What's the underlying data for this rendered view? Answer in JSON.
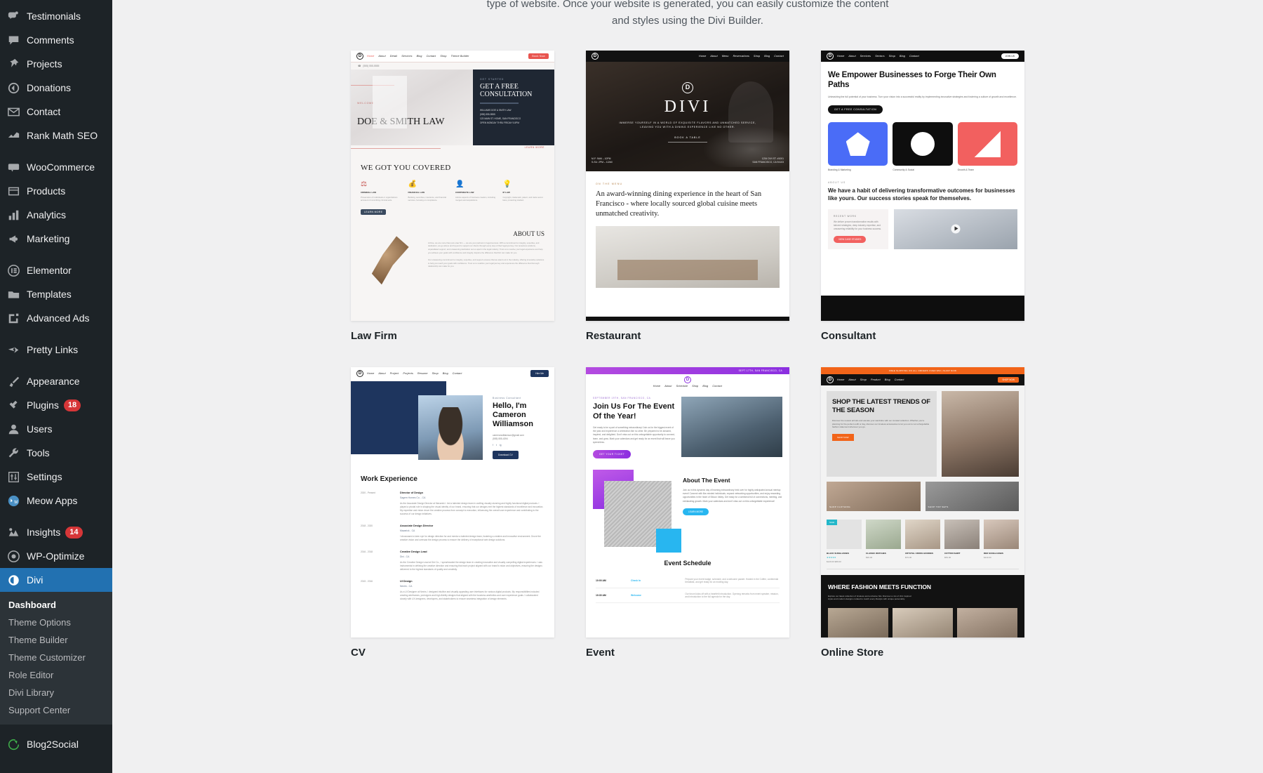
{
  "sidebar": {
    "items": [
      {
        "label": "Testimonials",
        "icon": "testimonials-icon",
        "badge": null
      },
      {
        "label": "Comments",
        "icon": "comments-icon",
        "badge": null
      },
      {
        "label": "Projects",
        "icon": "pin-icon",
        "badge": null
      },
      {
        "label": "Donations",
        "icon": "donations-icon",
        "badge": null
      },
      {
        "label": "Contact",
        "icon": "envelope-icon",
        "badge": null
      },
      {
        "label": "Rank Math SEO",
        "icon": "rankmath-icon",
        "badge": null
      },
      {
        "label": "WooCommerce",
        "icon": "woocommerce-icon",
        "badge": null,
        "sep_before": true
      },
      {
        "label": "Products",
        "icon": "products-icon",
        "badge": null
      },
      {
        "label": "Analytics",
        "icon": "analytics-icon",
        "badge": null
      },
      {
        "label": "Marketing",
        "icon": "megaphone-icon",
        "badge": null
      },
      {
        "label": "Elementor",
        "icon": "elementor-icon",
        "badge": null,
        "sep_before": true
      },
      {
        "label": "Templates",
        "icon": "folder-icon",
        "badge": null
      },
      {
        "label": "Advanced Ads",
        "icon": "ads-icon",
        "badge": null
      },
      {
        "label": "Pretty Links",
        "icon": "prettylinks-icon",
        "badge": null,
        "sep_before": true
      },
      {
        "label": "Appearance",
        "icon": "brush-icon",
        "badge": null,
        "sep_before": true
      },
      {
        "label": "Plugins",
        "icon": "plug-icon",
        "badge": "18"
      },
      {
        "label": "Users",
        "icon": "users-icon",
        "badge": null
      },
      {
        "label": "Tools",
        "icon": "wrench-icon",
        "badge": null
      },
      {
        "label": "Settings",
        "icon": "settings-icon",
        "badge": null
      },
      {
        "label": "Meow Apps",
        "icon": "meow-icon",
        "badge": null
      },
      {
        "label": "Insights",
        "icon": "insights-icon",
        "badge": "14",
        "sep_before": true
      },
      {
        "label": "WP-Optimize",
        "icon": "wpoptimize-icon",
        "badge": null
      }
    ],
    "active": {
      "label": "Divi",
      "icon": "divi-icon"
    },
    "submenu": [
      {
        "label": "Dashboard",
        "active": true
      },
      {
        "label": "Theme Options",
        "active": false
      },
      {
        "label": "Theme Builder",
        "active": false
      },
      {
        "label": "Theme Customizer",
        "active": false
      },
      {
        "label": "Role Editor",
        "active": false
      },
      {
        "label": "Divi Library",
        "active": false
      },
      {
        "label": "Support Center",
        "active": false
      }
    ],
    "after": [
      {
        "label": "Blog2Social",
        "icon": "blog2social-icon",
        "badge": null
      }
    ],
    "colors": {
      "bg": "#1d2327",
      "submenu_bg": "#2c3338",
      "active": "#2271b1",
      "badge": "#d63638"
    }
  },
  "intro": {
    "line1": "type of website. Once your website is generated, you can easily customize the content",
    "line2": "and styles using the Divi Builder."
  },
  "templates": [
    {
      "name": "Law Firm",
      "nav": [
        "Home",
        "About",
        "Detail",
        "Services",
        "Blog",
        "Contact",
        "Shop",
        "Theme Builder"
      ],
      "nav_cta": "Book Now",
      "phone": "(555) 555-5555",
      "eyebrow": "WELCOME",
      "title": "DOE & SMITH LAW",
      "panel_eyebrow": "GET STARTED",
      "panel_title": "GET A FREE CONSULTATION",
      "panel_lines": [
        "WILLIAMS DOE & SMITH LAW",
        "(555) 555-5555",
        "123 MAIN ST. HOME, SAN FRANCISCO",
        "OPEN MONDAY THRU FRIDAY 9-5PM"
      ],
      "learn_more": "LEARN MORE",
      "section_title": "WE GOT YOU COVERED",
      "practice": [
        "CRIMINAL LAW",
        "FINANCIAL LAW",
        "CORPORATE LAW",
        "IP LAW"
      ],
      "about_title": "ABOUT US",
      "accent": "#e8544f",
      "dark": "#1f2733"
    },
    {
      "name": "Restaurant",
      "nav": [
        "Home",
        "About",
        "Menu",
        "Reservations",
        "Shop",
        "Blog",
        "Contact"
      ],
      "hero_title": "DIVI",
      "hero_sub1": "IMMERSE YOURSELF IN A WORLD OF EXQUISITE FLAVORS AND UNMATCHED SERVICE,",
      "hero_sub2": "LEAVING YOU WITH A DINING EXPERIENCE LIKE NO OTHER.",
      "hero_cta": "BOOK A TABLE",
      "hours": [
        "M-F: 9AM – 10PM",
        "S-SU: 2PM – 12AM"
      ],
      "address": [
        "1234 DIVI ST. #1001",
        "SAN FRANCISCO, CA 94103"
      ],
      "body_eyebrow": "ON THE MENU",
      "body_quote": "An award-winning dining experience in the heart of San Francisco - where locally sourced global cuisine meets unmatched creativity.",
      "accent": "#b5824a",
      "dark": "#111111"
    },
    {
      "name": "Consultant",
      "nav": [
        "Home",
        "About",
        "Services",
        "Sectors",
        "Shop",
        "Blog",
        "Contact"
      ],
      "nav_cta": "JOIN US",
      "h1": "We Empower Businesses to Forge Their Own Paths",
      "p": "Unleashing the full potential of your business. Turn your vision into a successful reality by implementing innovative strategies and fostering a culture of growth and excellence.",
      "cta": "GET A FREE CONSULTATION",
      "services": [
        "Branding & Marketing",
        "Community & Social",
        "Growth & Team"
      ],
      "about_eyebrow": "ABOUT US",
      "h2": "We have a habit of delivering transformative outcomes for businesses like yours. Our success stories speak for themselves.",
      "recent_eyebrow": "RECENT WORK",
      "recent_p": "We deliver proven transformative results with tailored strategies, deep industry expertise, and unwavering reliability for your business success.",
      "recent_cta": "VIEW CASE STUDIES",
      "colors": {
        "blue": "#4a6cf7",
        "black": "#0e0e0e",
        "red": "#f2605f"
      }
    },
    {
      "name": "CV",
      "nav": [
        "Home",
        "About",
        "Project",
        "Projects",
        "Resume",
        "Shop",
        "Blog",
        "Contact"
      ],
      "nav_cta": "Hire Me",
      "eyebrow": "Business Consultant",
      "h1": "Hello, I'm Cameron Williamson",
      "email": "cameronwilliamson@gmail.com",
      "phone": "(555) 555-4394",
      "download": "Download CV",
      "section_title": "Work Experience",
      "jobs": [
        {
          "date": "2020 - Present",
          "title": "Director of Design",
          "company": "Sagem Homes Co. - CA",
          "desc": "As the Associate Design Director at Mavarick I. led a talented design team in crafting visually stunning and highly functional digital products. I played a pivotal role in shaping the visual identity of our brand, ensuring that our designs met the highest standards of excellence and innovation. My expertise and vision drove the creative process from concept to execution, influencing the overall user experience and contributing to the success of our design initiatives."
        },
        {
          "date": "2018 - 2020",
          "title": "Associate Design Director",
          "company": "Mavarick - CA",
          "desc": "I showcased a keen eye for design direction for and mentor a talented design team, fostering a creative and innovative environment. Drove the creative vision and oversaw the design process to ensure the delivery of exceptional web design solutions."
        },
        {
          "date": "2016 - 2018",
          "title": "Creative Design Lead",
          "company": "Divi - CA",
          "desc": "As the Creative Design Lead at Divi Co., I spearheaded the design team in creating innovative and visually compelling digital experiences. I was instrumental in defining the creative direction and ensuring that each project aligned with our brand's vision and objectives, ensuring the designs delivered to the highest standards of quality and creativity."
        },
        {
          "date": "2015 - 2016",
          "title": "UI Design",
          "company": "Nexim - CA",
          "desc": "As a UI Designer at Nexim, I designed intuitive and visually appealing user interfaces for various digital products. My responsibilities included creating wireframes, prototypes and high-fidelity designs that aligned with the business aesthetics and user experience goals. I collaborated closely with UX designers, developers, and stakeholders to ensure seamless integration of design elements."
        }
      ],
      "accent": "#1e355e"
    },
    {
      "name": "Event",
      "top_bar": "SEPT 17TH, SAN FRANCISCO, CA",
      "nav": [
        "Home",
        "About",
        "Schedule",
        "Shop",
        "Blog",
        "Contact"
      ],
      "eyebrow": "SEPTEMBER 19TH, SAN FRANCISCO, CA",
      "h1": "Join Us For The Event Of the Year!",
      "p": "Get ready to be a part of something extraordinary! Join us for the biggest event of the year and experience a celebration like no other. Be prepared to be amazed, inspired, and delighted. Don't miss out on this unforgettable opportunity to connect, learn, and grow. Mark your calendars and get ready for an event that will leave you speechless.",
      "cta": "GET YOUR TICKET",
      "about_title": "About The Event",
      "about_p": "Join us in this dynamic day of learning extraordinary held over for highly anticipated annual meetup event! Connect with like-minded individuals, expand networking opportunities, and enjoy rewarding opportunities in the heart of Silicon Valley. Get ready for a weekend full of connections, meeting, and exhilarating growth. Mark your calendars and don't miss out on this unforgettable experience!",
      "about_cta": "LEARN MORE",
      "schedule_title": "Event Schedule",
      "schedule": [
        {
          "time": "10:00 AM",
          "name": "Check In",
          "desc": "Prepare your event badge, schedule, and a welcome packet. Hosted in the Coffee, continental breakfast, and get ready for an exciting day."
        },
        {
          "time": "10:30 AM",
          "name": "Welcome",
          "desc": "Our forum kicks off with a heartfelt introduction. Opening remarks from event speaker, mission, and introduction to the full agenda for the day."
        }
      ],
      "colors": {
        "purple": "#8b2fe0",
        "purple_light": "#b44be0",
        "blue": "#28b6f0"
      }
    },
    {
      "name": "Online Store",
      "top_bar": "FREE SHIPPING ON ALL ORDERS OVER $50 | SHOP NOW",
      "nav": [
        "Home",
        "About",
        "Shop",
        "Product",
        "Blog",
        "Contact"
      ],
      "nav_cta": "SHOP NOW",
      "h1": "SHOP THE LATEST TRENDS OF THE SEASON",
      "p": "Discover the newest arrivals and elevate your wardrobe with our curated collection. Whether you're planning for the perfect outfit or day, discover our timeless accessories to let you out to not unforgettable fashion statement wherever you go.",
      "cta": "SHOP NOW",
      "tiles": [
        "SHOP CLOTHING",
        "SHOP TOP SETS"
      ],
      "products": [
        {
          "name": "BLACK SUNGLASSES",
          "stars": "★★★★★",
          "price": "$129.00 $89.00",
          "sale": "SALE"
        },
        {
          "name": "CLASSIC WATCHES",
          "stars": "",
          "price": "$99.00",
          "sale": ""
        },
        {
          "name": "CRYSTAL CROSS HOODIES",
          "stars": "",
          "price": "$79.00",
          "sale": ""
        },
        {
          "name": "COTTON SHIRT",
          "stars": "",
          "price": "$59.00",
          "sale": ""
        },
        {
          "name": "RED SUNGLASSES",
          "stars": "",
          "price": "$119.00",
          "sale": ""
        }
      ],
      "dark_h2": "WHERE FASHION MEETS FUNCTION",
      "dark_p": "Explore our latest collection of timeless and exclusive hits. Discover a mix of chic inspired styles and modern designs curated to match every lifestyle with unique personality.",
      "accent": "#f26419",
      "sale_color": "#23b7c9"
    }
  ]
}
